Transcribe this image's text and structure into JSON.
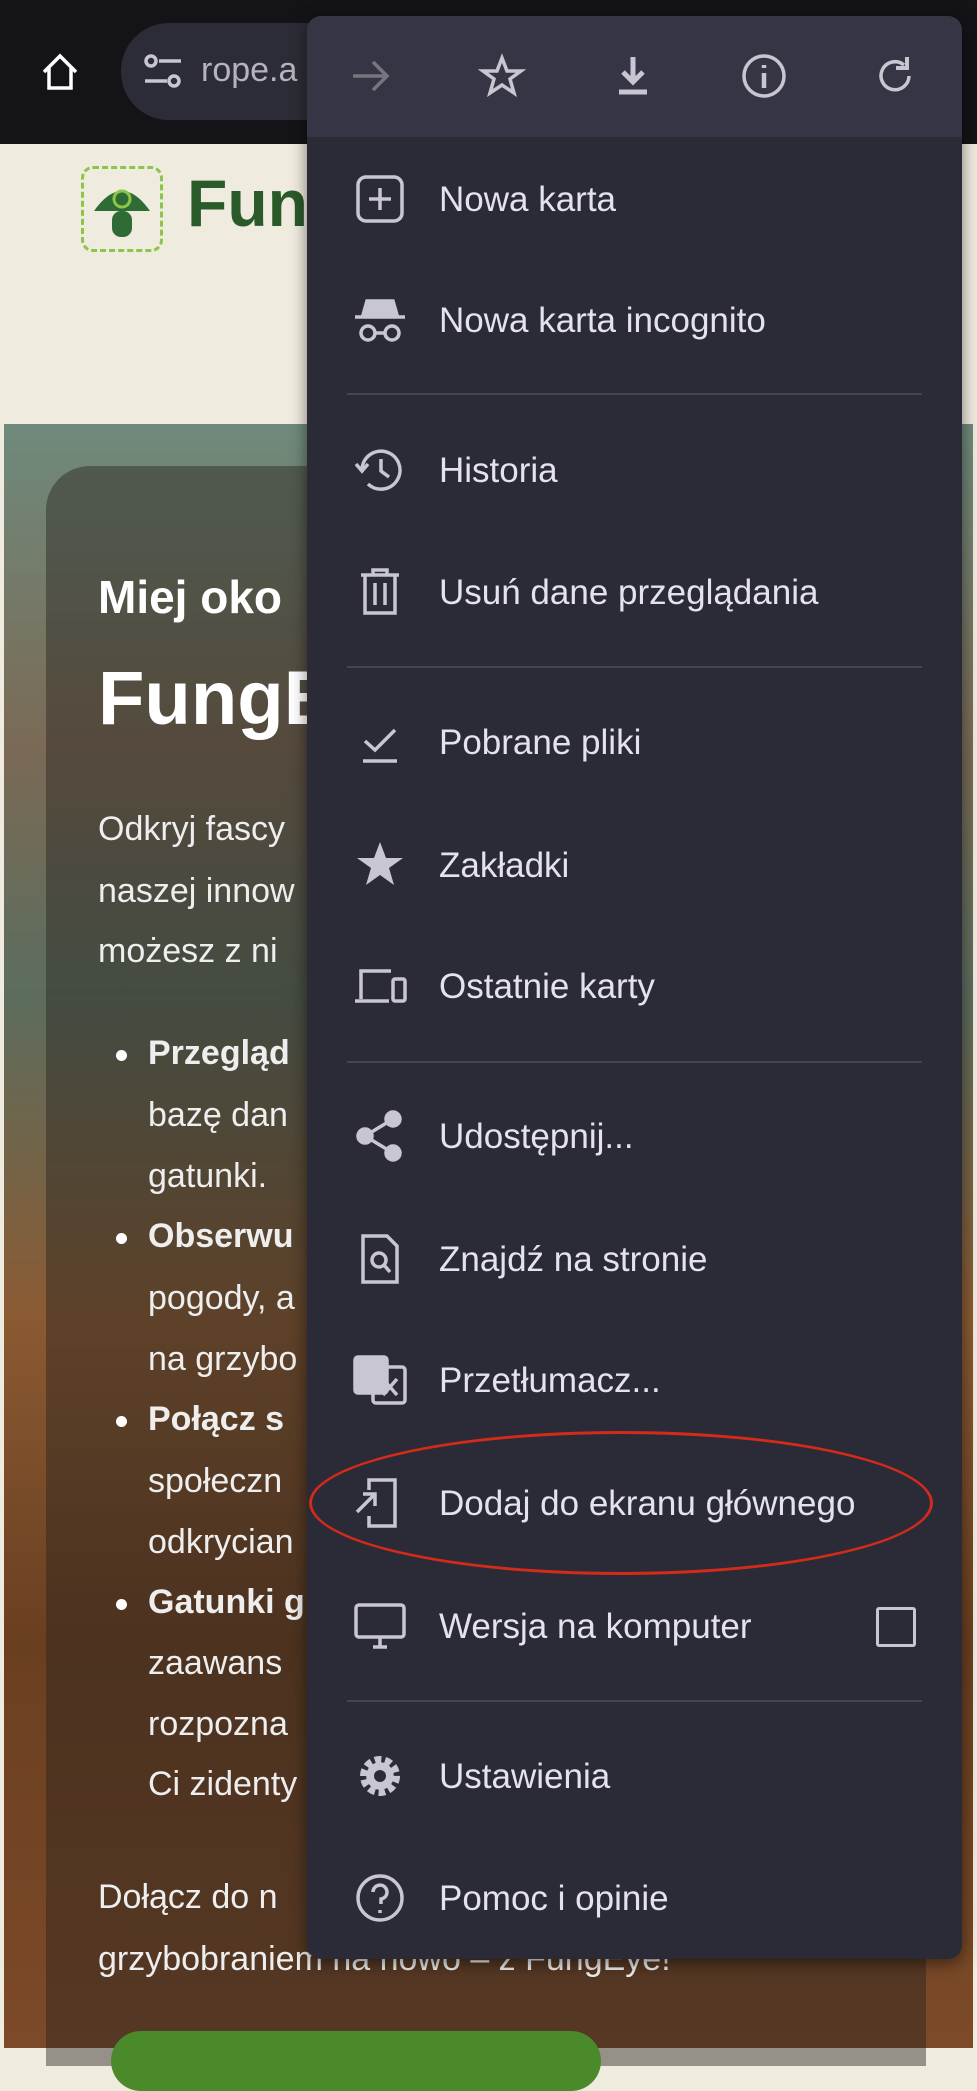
{
  "browser": {
    "url_fragment": "rope.a",
    "icons": [
      "home-icon",
      "tune-icon"
    ]
  },
  "page": {
    "brand": "Fung",
    "hero_kicker": "Miej oko",
    "hero_title": "FungE",
    "intro": [
      "Odkryj fascy",
      "naszej innow",
      "możesz z ni"
    ],
    "bullets": [
      {
        "bold": "Przegląd",
        "lines": [
          "bazę dan",
          "gatunki."
        ]
      },
      {
        "bold": "Obserwu",
        "lines": [
          "pogody, a",
          "na grzybo"
        ]
      },
      {
        "bold": "Połącz s",
        "lines": [
          "społeczn",
          "odkrycian"
        ]
      },
      {
        "bold": "Gatunki g",
        "lines": [
          "zaawans",
          "rozpozna",
          "Ci zidenty"
        ]
      }
    ],
    "outro": [
      "Dołącz do n",
      "grzybobraniem na nowo – z FungEye!"
    ]
  },
  "menu": {
    "toolbar": [
      "forward-icon",
      "bookmark-star-icon",
      "download-icon",
      "info-icon",
      "reload-icon"
    ],
    "items": [
      {
        "label": "Nowa karta",
        "icon": "new-tab-icon"
      },
      {
        "label": "Nowa karta incognito",
        "icon": "incognito-icon"
      },
      {
        "label": "Historia",
        "icon": "history-icon"
      },
      {
        "label": "Usuń dane przeglądania",
        "icon": "trash-icon"
      },
      {
        "label": "Pobrane pliki",
        "icon": "downloads-icon"
      },
      {
        "label": "Zakładki",
        "icon": "star-icon"
      },
      {
        "label": "Ostatnie karty",
        "icon": "devices-icon"
      },
      {
        "label": "Udostępnij...",
        "icon": "share-icon"
      },
      {
        "label": "Znajdź na stronie",
        "icon": "find-in-page-icon"
      },
      {
        "label": "Przetłumacz...",
        "icon": "translate-icon"
      },
      {
        "label": "Dodaj do ekranu głównego",
        "icon": "add-to-home-icon"
      },
      {
        "label": "Wersja na komputer",
        "icon": "desktop-icon",
        "checked": false
      },
      {
        "label": "Ustawienia",
        "icon": "settings-icon"
      },
      {
        "label": "Pomoc i opinie",
        "icon": "help-icon"
      }
    ]
  },
  "annotation": {
    "highlight_color": "#d42a1a"
  }
}
